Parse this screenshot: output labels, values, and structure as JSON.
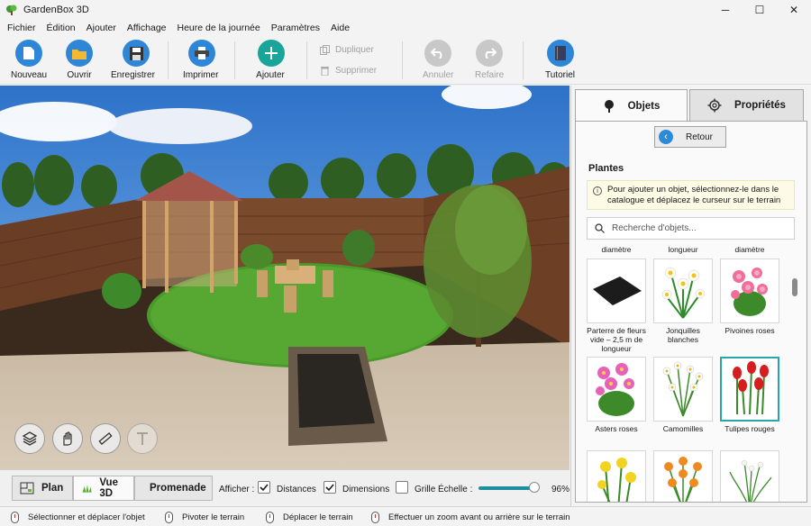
{
  "window": {
    "title": "GardenBox 3D",
    "controls": [
      "minimize-icon",
      "maximize-icon",
      "close-icon"
    ]
  },
  "menu": [
    "Fichier",
    "Édition",
    "Ajouter",
    "Affichage",
    "Heure de la journée",
    "Paramètres",
    "Aide"
  ],
  "toolbar": {
    "new": "Nouveau",
    "open": "Ouvrir",
    "save": "Enregistrer",
    "print": "Imprimer",
    "add": "Ajouter",
    "duplicate": "Dupliquer",
    "delete": "Supprimer",
    "undo": "Annuler",
    "redo": "Refaire",
    "tutorial": "Tutoriel"
  },
  "views": {
    "plan": "Plan",
    "view3d": "Vue 3D",
    "walk": "Promenade"
  },
  "display": {
    "show_label": "Afficher :",
    "distances": "Distances",
    "dimensions": "Dimensions",
    "grid": "Grille",
    "scale_label": "Échelle :",
    "scale_value": "96%",
    "scale_fraction": 0.96,
    "distances_checked": true,
    "dimensions_checked": true,
    "grid_checked": false
  },
  "panel": {
    "tab_objects": "Objets",
    "tab_properties": "Propriétés",
    "back": "Retour",
    "section": "Plantes",
    "info": "Pour ajouter un objet, sélectionnez-le dans le catalogue et déplacez le curseur sur le terrain",
    "search_placeholder": "Recherche d'objets...",
    "top_captions": [
      "diamètre",
      "longueur",
      "diamètre"
    ],
    "items": [
      {
        "name": "Parterre de fleurs vide – 2,5 m de longueur"
      },
      {
        "name": "Jonquilles blanches"
      },
      {
        "name": "Pivoines roses"
      },
      {
        "name": "Asters roses"
      },
      {
        "name": "Camomilles"
      },
      {
        "name": "Tulipes rouges"
      }
    ]
  },
  "status": [
    "Sélectionner et déplacer l'objet",
    "Pivoter le terrain",
    "Déplacer le terrain",
    "Effectuer un zoom avant ou arrière sur le terrain"
  ],
  "colors": {
    "accent": "#1f8fa0",
    "selected_border": "#28a6a6",
    "add_button": "#1aa59a"
  }
}
